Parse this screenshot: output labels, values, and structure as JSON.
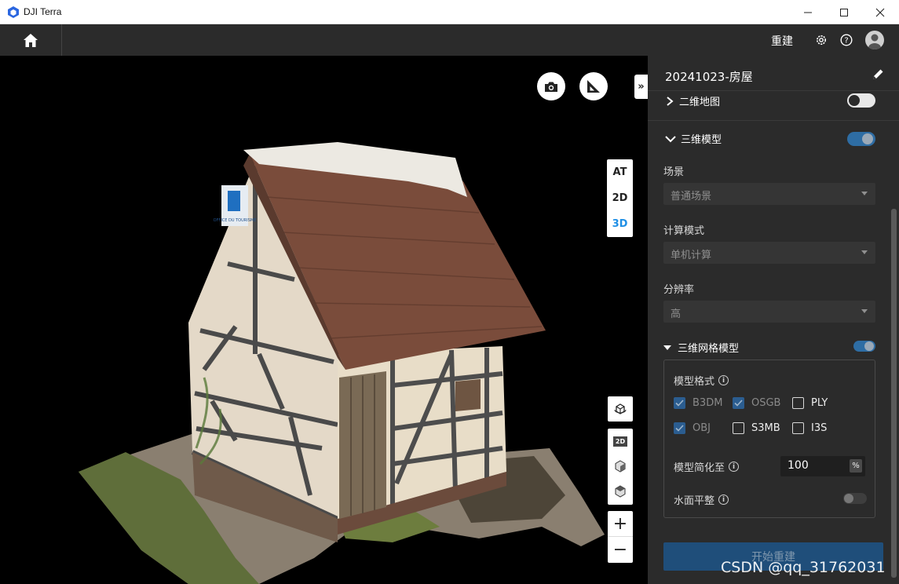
{
  "window": {
    "title": "DJI Terra",
    "minimize_icon": "minimize-icon",
    "maximize_icon": "maximize-icon",
    "close_icon": "close-icon"
  },
  "topbar": {
    "home_icon": "home-icon",
    "rebuild_label": "重建",
    "settings_icon": "gear-icon",
    "help_icon": "help-icon",
    "avatar_icon": "avatar-icon"
  },
  "viewport": {
    "camera_icon": "camera-icon",
    "measure_icon": "ruler-triangle-icon",
    "collapse_label": "»",
    "view_modes": [
      "AT",
      "2D",
      "3D"
    ],
    "active_view_mode": "3D",
    "tools": {
      "compass_icon": "compass-cube-icon",
      "view_2d_label": "2D",
      "view_3d_icon": "cube-icon",
      "view_top_icon": "cube-top-icon",
      "zoom_in_label": "+",
      "zoom_out_label": "−"
    },
    "sign_text": "OFFICE DU TOURISME"
  },
  "panel": {
    "project_title": "20241023-房屋",
    "edit_icon": "pencil-icon",
    "sections": {
      "map2d": {
        "label": "二维地图",
        "expanded": false,
        "enabled": false
      },
      "model3d": {
        "label": "三维模型",
        "expanded": true,
        "enabled": true
      }
    },
    "scene": {
      "label": "场景",
      "value": "普通场景"
    },
    "compute_mode": {
      "label": "计算模式",
      "value": "单机计算"
    },
    "resolution": {
      "label": "分辨率",
      "value": "高"
    },
    "mesh": {
      "label": "三维网格模型",
      "enabled": true,
      "format_label": "模型格式",
      "formats": [
        {
          "name": "B3DM",
          "checked": true
        },
        {
          "name": "OSGB",
          "checked": true
        },
        {
          "name": "PLY",
          "checked": false
        },
        {
          "name": "OBJ",
          "checked": true
        },
        {
          "name": "S3MB",
          "checked": false
        },
        {
          "name": "I3S",
          "checked": false
        }
      ],
      "simplify_label": "模型简化至",
      "simplify_value": "100",
      "simplify_unit": "%",
      "water_label": "水面平整",
      "water_enabled": false
    },
    "start_button": "开始重建"
  },
  "watermark": "CSDN @qq_31762031",
  "colors": {
    "accent": "#1f8fe5",
    "toggle_on": "#2e6da4",
    "panel_bg": "#2b2b2b",
    "checkbox_on": "#2b5d90",
    "button_primary": "#1f4e7a"
  }
}
